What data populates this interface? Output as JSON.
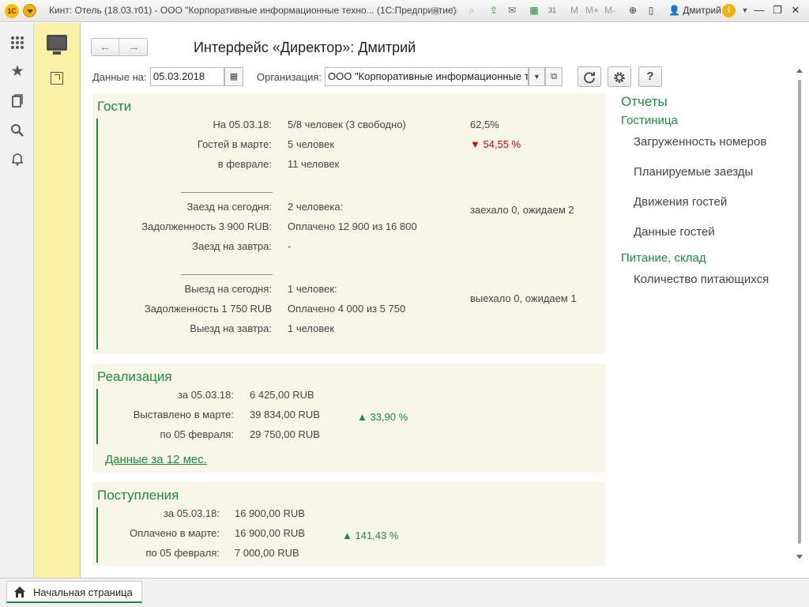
{
  "window": {
    "logo_text": "1С",
    "title": "Кинт: Отель (18.03.т01) - ООО \"Корпоративные информационные техно...  (1С:Предприятие)",
    "user": "Дмитрий"
  },
  "toolbar_icons": [
    "save-icon",
    "print-icon",
    "print-preview-icon",
    "upload-icon",
    "mail-icon",
    "calculator-icon",
    "calendar-icon",
    "memory-m-icon",
    "memory-mplus-icon",
    "memory-mminus-icon",
    "zoom-icon",
    "panel-icon"
  ],
  "toolbar_glyphs": {
    "m": "M",
    "mplus": "M+",
    "mminus": "M-",
    "info": "i"
  },
  "left_bar_icons": [
    "apps-grid-icon",
    "favorites-star-icon",
    "history-icon",
    "search-icon",
    "notifications-bell-icon"
  ],
  "page": {
    "title": "Интерфейс «Директор»: Дмитрий",
    "data_label": "Данные на:",
    "date_value": "05.03.2018",
    "org_label": "Организация:",
    "org_value": "ООО \"Корпоративные информационные те",
    "help_label": "?"
  },
  "guests": {
    "title": "Гости",
    "rows": [
      {
        "label": "На 05.03.18:",
        "value": "5/8 человек (3 свободно)",
        "extra": "62,5%"
      },
      {
        "label": "Гостей в марте:",
        "value": "5 человек",
        "extra": "▼ 54,55 %"
      },
      {
        "label": "в феврале:",
        "value": "11 человек",
        "extra": ""
      }
    ],
    "arrival": {
      "today_label": "Заезд на сегодня:",
      "today_value": "2 человека:",
      "debt_label": "Задолженность 3 900 RUB:",
      "debt_value": "Оплачено 12 900 из 16 800",
      "status": "заехало 0, ожидаем 2",
      "tomorrow_label": "Заезд на завтра:",
      "tomorrow_value": "-"
    },
    "departure": {
      "today_label": "Выезд на сегодня:",
      "today_value": "1 человек:",
      "debt_label": "Задолженность 1 750 RUB",
      "debt_value": "Оплачено 4 000 из 5 750",
      "status": "выехало 0, ожидаем 1",
      "tomorrow_label": "Выезд на завтра:",
      "tomorrow_value": "1 человек"
    }
  },
  "sales": {
    "title": "Реализация",
    "rows": [
      {
        "label": "за 05.03.18:",
        "value": "6 425,00 RUB",
        "extra": ""
      },
      {
        "label": "Выставлено в марте:",
        "value": "39 834,00 RUB",
        "extra": "▲ 33,90 %"
      },
      {
        "label": "по 05 февраля:",
        "value": "29 750,00 RUB",
        "extra": ""
      }
    ],
    "link": "Данные за 12 мес."
  },
  "receipts": {
    "title": "Поступления",
    "rows": [
      {
        "label": "за 05.03.18:",
        "value": "16 900,00 RUB",
        "extra": ""
      },
      {
        "label": "Оплачено в марте:",
        "value": "16 900,00 RUB",
        "extra": "▲ 141,43 %"
      },
      {
        "label": "по 05 февраля:",
        "value": "7 000,00 RUB",
        "extra": ""
      }
    ]
  },
  "reports": {
    "title": "Отчеты",
    "hotel_group": "Гостиница",
    "hotel_items": [
      "Загруженность номеров",
      "Планируемые заезды",
      "Движения гостей",
      "Данные гостей"
    ],
    "food_group": "Питание, склад",
    "food_items": [
      "Количество питающихся"
    ]
  },
  "bottom": {
    "home_tab": "Начальная страница"
  },
  "colors": {
    "accent_green": "#1c8b3d",
    "down_red": "#e00000",
    "panel_yellow": "#fbf1a6",
    "section_bg": "#f8f6e7"
  }
}
